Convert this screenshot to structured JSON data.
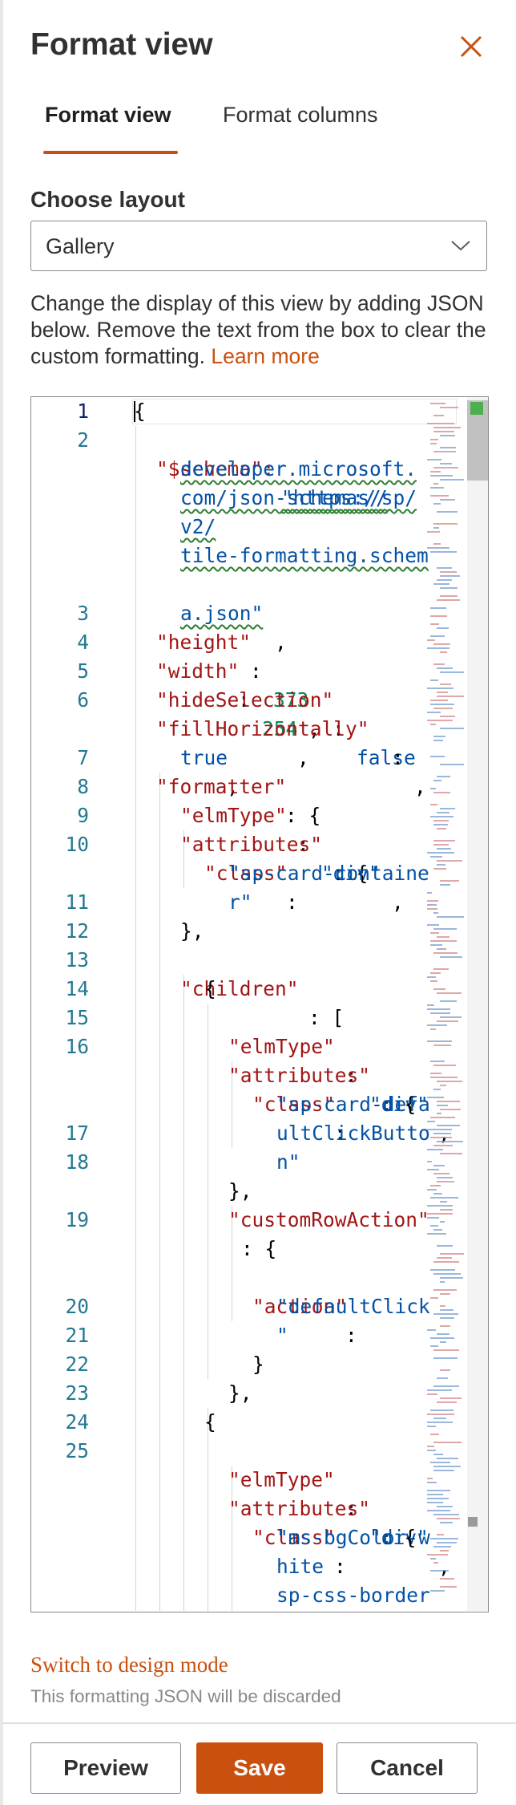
{
  "panel": {
    "title": "Format view",
    "close_icon": "close-icon"
  },
  "tabs": [
    {
      "label": "Format view",
      "active": true
    },
    {
      "label": "Format columns",
      "active": false
    }
  ],
  "layout": {
    "label": "Choose layout",
    "selected": "Gallery",
    "chevron_icon": "chevron-down-icon"
  },
  "description": {
    "text": "Change the display of this view by adding JSON below. Remove the text from the box to clear the custom formatting.",
    "link": "Learn more"
  },
  "editor": {
    "lines": [
      {
        "n": "1",
        "active": true
      },
      {
        "n": "2"
      },
      {
        "n": ""
      },
      {
        "n": ""
      },
      {
        "n": ""
      },
      {
        "n": ""
      },
      {
        "n": ""
      },
      {
        "n": "3"
      },
      {
        "n": "4"
      },
      {
        "n": "5"
      },
      {
        "n": "6"
      },
      {
        "n": ""
      },
      {
        "n": "7"
      },
      {
        "n": "8"
      },
      {
        "n": "9"
      },
      {
        "n": "10"
      },
      {
        "n": ""
      },
      {
        "n": "11"
      },
      {
        "n": "12"
      },
      {
        "n": "13"
      },
      {
        "n": "14"
      },
      {
        "n": "15"
      },
      {
        "n": "16"
      },
      {
        "n": ""
      },
      {
        "n": ""
      },
      {
        "n": "17"
      },
      {
        "n": "18"
      },
      {
        "n": ""
      },
      {
        "n": "19"
      },
      {
        "n": ""
      },
      {
        "n": ""
      },
      {
        "n": "20"
      },
      {
        "n": "21"
      },
      {
        "n": "22"
      },
      {
        "n": "23"
      },
      {
        "n": "24"
      },
      {
        "n": "25"
      },
      {
        "n": ""
      },
      {
        "n": ""
      },
      {
        "n": ""
      }
    ],
    "code": [
      "{",
      "\"$schema\": ",
      "\"https://",
      "developer.microsoft.",
      "com/json-schemas/sp/",
      "v2/",
      "tile-formatting.schem",
      "a.json\"",
      ",",
      "\"height\"",
      ": ",
      "373",
      ",",
      "\"width\"",
      ": ",
      "254",
      ",",
      "\"hideSelection\"",
      ": ",
      "false",
      ",",
      "\"fillHorizontally\"",
      ":",
      "true",
      ",",
      "\"formatter\"",
      ": {",
      "\"elmType\"",
      ": ",
      "\"div\"",
      ",",
      "\"attributes\"",
      ": {",
      "\"class\"",
      ":",
      "\"sp-card-containe",
      "r\"",
      "},",
      "\"children\"",
      ": [",
      "{",
      "\"elmType\"",
      ": ",
      "\"div\"",
      ",",
      "\"attributes\"",
      ": {",
      "\"class\"",
      ":",
      "\"sp-card-defa",
      "ultClickButto",
      "n\"",
      "},",
      "\"customRowAction\"",
      ": {",
      "\"action\"",
      ":",
      "\"defaultClick",
      "\"",
      "}",
      "},",
      "{",
      "\"elmType\"",
      ": ",
      "\"div\"",
      ",",
      "\"attributes\"",
      ": {",
      "\"class\"",
      ":",
      "\"ms-bgColor-w",
      "hite",
      "sp-css-border"
    ]
  },
  "design": {
    "switch_label": "Switch to design mode",
    "discard_note": "This formatting JSON will be discarded"
  },
  "footer": {
    "preview": "Preview",
    "save": "Save",
    "cancel": "Cancel"
  },
  "colors": {
    "accent": "#ca5010",
    "line_number": "#237893",
    "json_key": "#a31515",
    "json_string": "#0451a5",
    "json_number": "#098658"
  }
}
